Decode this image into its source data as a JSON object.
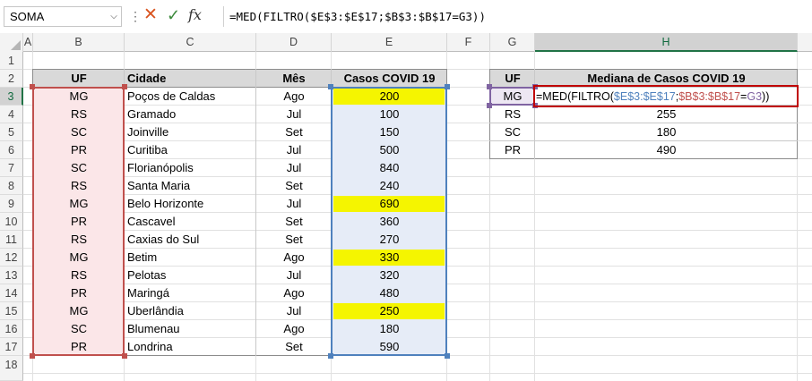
{
  "formula_bar": {
    "name_box": "SOMA",
    "formula": "=MED(FILTRO($E$3:$E$17;$B$3:$B$17=G3))",
    "cancel_icon": "x-icon",
    "enter_icon": "check-icon",
    "fx_label": "fx"
  },
  "columns": [
    "A",
    "B",
    "C",
    "D",
    "E",
    "F",
    "G",
    "H"
  ],
  "rows": [
    "1",
    "2",
    "3",
    "4",
    "5",
    "6",
    "7",
    "8",
    "9",
    "10",
    "11",
    "12",
    "13",
    "14",
    "15",
    "16",
    "17",
    "18"
  ],
  "table1": {
    "headers": [
      "UF",
      "Cidade",
      "Mês",
      "Casos COVID 19"
    ],
    "rows": [
      [
        "MG",
        "Poços de Caldas",
        "Ago",
        "200"
      ],
      [
        "RS",
        "Gramado",
        "Jul",
        "100"
      ],
      [
        "SC",
        "Joinville",
        "Set",
        "150"
      ],
      [
        "PR",
        "Curitiba",
        "Jul",
        "500"
      ],
      [
        "SC",
        "Florianópolis",
        "Jul",
        "840"
      ],
      [
        "RS",
        "Santa Maria",
        "Set",
        "240"
      ],
      [
        "MG",
        "Belo Horizonte",
        "Jul",
        "690"
      ],
      [
        "PR",
        "Cascavel",
        "Set",
        "360"
      ],
      [
        "RS",
        "Caxias do Sul",
        "Set",
        "270"
      ],
      [
        "MG",
        "Betim",
        "Ago",
        "330"
      ],
      [
        "RS",
        "Pelotas",
        "Jul",
        "320"
      ],
      [
        "PR",
        "Maringá",
        "Ago",
        "480"
      ],
      [
        "MG",
        "Uberlândia",
        "Jul",
        "250"
      ],
      [
        "SC",
        "Blumenau",
        "Ago",
        "180"
      ],
      [
        "PR",
        "Londrina",
        "Set",
        "590"
      ]
    ]
  },
  "table2": {
    "headers": [
      "UF",
      "Mediana de Casos COVID 19"
    ],
    "rows": [
      [
        "MG",
        "=MED(FILTRO($E$3:$E$17;$B$3:$B$17=G3))"
      ],
      [
        "RS",
        "255"
      ],
      [
        "SC",
        "180"
      ],
      [
        "PR",
        "490"
      ]
    ],
    "formula_parts": {
      "p1": "=MED(FILTRO(",
      "p2": "$E$3:$E$17",
      "p3": ";",
      "p4": "$B$3:$B$17",
      "p5": "=",
      "p6": "G3",
      "p7": "))"
    }
  },
  "colors": {
    "highlight_yellow": "#f5f500",
    "range_b_fill": "#fbe6e8",
    "range_b_border": "#c0504d",
    "range_e_fill": "#e6ecf7",
    "range_e_border": "#4f81bd",
    "g3_border": "#8064a2",
    "active_border": "#c00000"
  }
}
